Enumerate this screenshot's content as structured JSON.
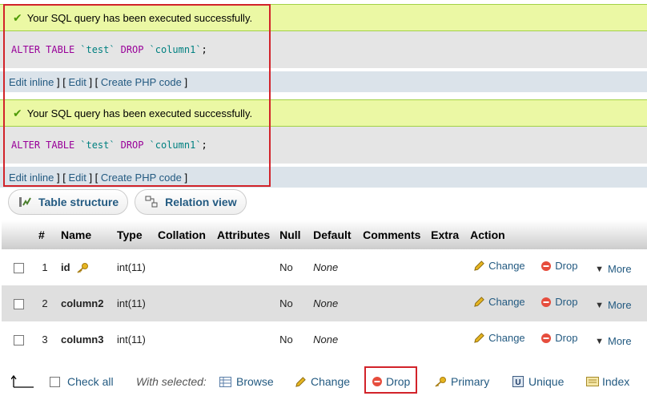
{
  "results": [
    {
      "message": "Your SQL query has been executed successfully.",
      "sql": {
        "kw1": "ALTER",
        "kw2": "TABLE",
        "table": "`test`",
        "kw3": "DROP",
        "column": "`column1`",
        "end": ";"
      },
      "links": {
        "open1": "",
        "edit_inline": "Edit inline",
        "sep1": " ] [ ",
        "edit": "Edit",
        "sep2": " ] [ ",
        "create_php": "Create PHP code",
        "close": " ]"
      }
    },
    {
      "message": "Your SQL query has been executed successfully.",
      "sql": {
        "kw1": "ALTER",
        "kw2": "TABLE",
        "table": "`test`",
        "kw3": "DROP",
        "column": "`column1`",
        "end": ";"
      },
      "links": {
        "open1": "",
        "edit_inline": "Edit inline",
        "sep1": " ] [ ",
        "edit": "Edit",
        "sep2": " ] [ ",
        "create_php": "Create PHP code",
        "close": " ]"
      }
    }
  ],
  "tabs": {
    "structure": "Table structure",
    "relation": "Relation view"
  },
  "table": {
    "headers": [
      "",
      "#",
      "Name",
      "Type",
      "Collation",
      "Attributes",
      "Null",
      "Default",
      "Comments",
      "Extra",
      "Action"
    ],
    "rows": [
      {
        "num": "1",
        "name": "id",
        "type": "int(11)",
        "null": "No",
        "default": "None",
        "primary_key_icon": "key-icon"
      },
      {
        "num": "2",
        "name": "column2",
        "type": "int(11)",
        "null": "No",
        "default": "None"
      },
      {
        "num": "3",
        "name": "column3",
        "type": "int(11)",
        "null": "No",
        "default": "None"
      }
    ],
    "actions": {
      "change": "Change",
      "drop": "Drop",
      "more": "More"
    }
  },
  "bottom": {
    "check_all": "Check all",
    "with_selected": "With selected:",
    "browse": "Browse",
    "change": "Change",
    "drop": "Drop",
    "primary": "Primary",
    "unique": "Unique",
    "index": "Index"
  },
  "colors": {
    "link": "#235a81",
    "success_bg": "#ebf8a4",
    "highlight_frame": "#d2232a"
  }
}
